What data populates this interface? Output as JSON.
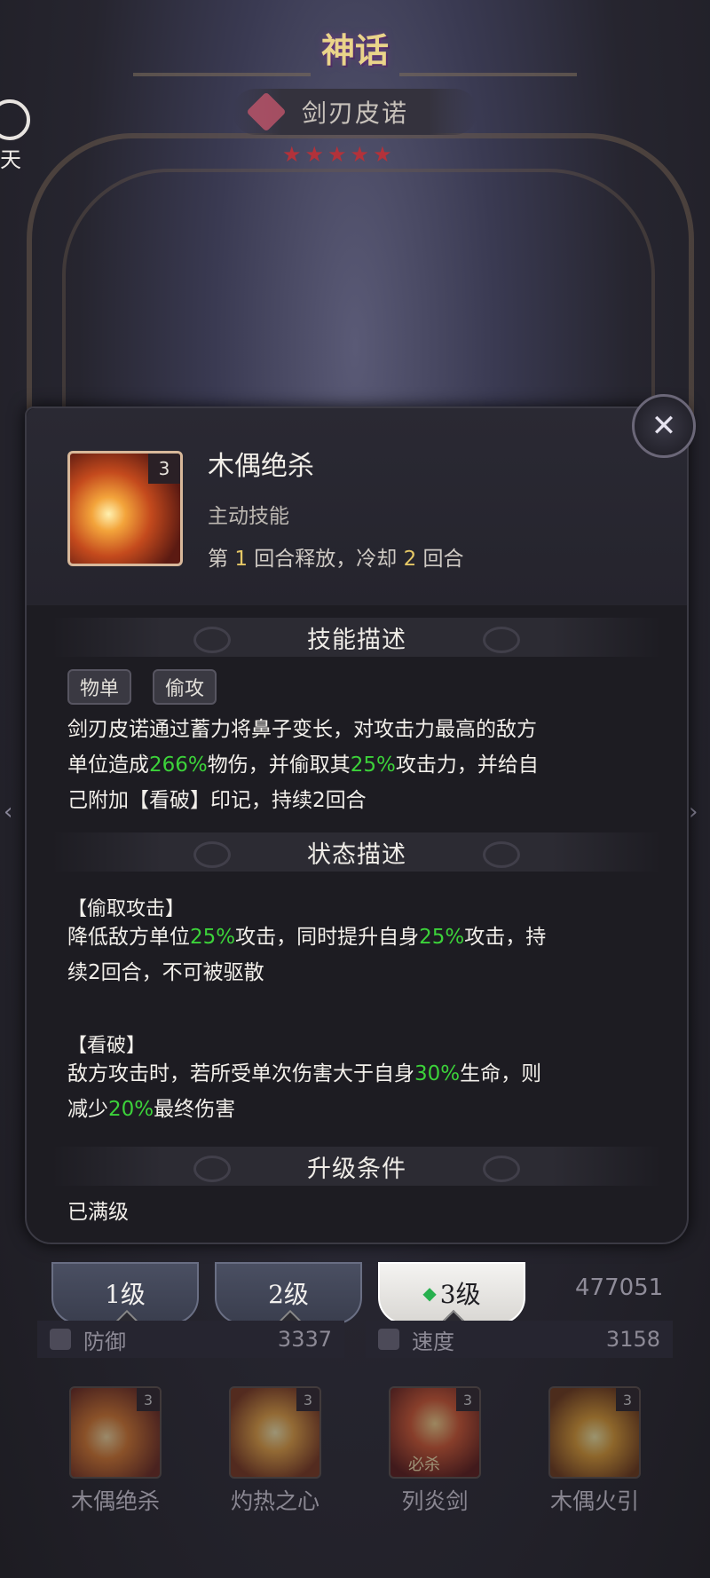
{
  "header": {
    "rarity_badge": "神话",
    "hero_name": "剑刃皮诺",
    "stars": "★★★★★",
    "side_button_label": "天"
  },
  "popup": {
    "close_icon": "close-x-icon",
    "skill": {
      "name": "木偶绝杀",
      "level": "3",
      "type": "主动技能",
      "release_prefix": "第",
      "release_round": "1",
      "release_mid": "回合释放，冷却",
      "cooldown": "2",
      "release_suffix": "回合"
    },
    "sections": {
      "skill_desc_title": "技能描述",
      "state_desc_title": "状态描述",
      "upgrade_title": "升级条件"
    },
    "tags": [
      "物单",
      "偷攻"
    ],
    "skill_desc": {
      "p1": "剑刃皮诺通过蓄力将鼻子变长，对攻击力最高的敌方",
      "p2a": "单位造成",
      "p2b": "266%",
      "p2c": "物伤，并偷取其",
      "p2d": "25%",
      "p2e": "攻击力，并给自",
      "p3": "己附加【看破】印记，持续2回合"
    },
    "state1": {
      "title": "【偷取攻击】",
      "l1a": "降低敌方单位",
      "l1b": "25%",
      "l1c": "攻击，同时提升自身",
      "l1d": "25%",
      "l1e": "攻击，持",
      "l2": "续2回合，不可被驱散"
    },
    "state2": {
      "title": "【看破】",
      "l1a": "敌方攻击时，若所受单次伤害大于自身",
      "l1b": "30%",
      "l1c": "生命，则",
      "l2a": "减少",
      "l2b": "20%",
      "l2c": "最终伤害"
    },
    "upgrade_text": "已满级",
    "highlight_color": "#3cd23a"
  },
  "bottom": {
    "level_tabs": [
      "1级",
      "2级",
      "3级"
    ],
    "power_value": "477051",
    "stats": [
      {
        "label": "防御",
        "value": "3337"
      },
      {
        "label": "速度",
        "value": "3158"
      }
    ],
    "skills": [
      {
        "name": "木偶绝杀",
        "level": "3"
      },
      {
        "name": "灼热之心",
        "level": "3"
      },
      {
        "name": "列炎剑",
        "level": "3",
        "badge": "必杀"
      },
      {
        "name": "木偶火引",
        "level": "3"
      }
    ]
  }
}
